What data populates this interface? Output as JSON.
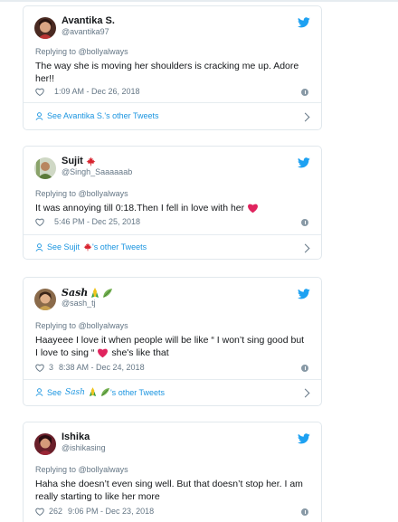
{
  "colors": {
    "twitter_blue": "#1da1f2",
    "link_blue": "#1b95e0",
    "muted": "#657786",
    "heart_red": "#e0245e"
  },
  "tweets": [
    {
      "name": "Avantika S.",
      "handle": "@avantika97",
      "replying_to": "Replying to @bollyalways",
      "text": "The way she is moving her shoulders is cracking me up. Adore her!!",
      "likes": "",
      "time": "1:09 AM - Dec 26, 2018",
      "see_more": "See Avantika S.'s other Tweets"
    },
    {
      "name": "Sujit",
      "handle": "@Singh_Saaaaaab",
      "replying_to": "Replying to @bollyalways",
      "text": "It was annoying till 0:18.Then I fell in love with her",
      "likes": "",
      "time": "5:46 PM - Dec 25, 2018",
      "see_more_prefix": "See Sujit",
      "see_more_suffix": "'s other Tweets"
    },
    {
      "name": "Sash",
      "handle": "@sash_tj",
      "replying_to": "Replying to @bollyalways",
      "text_line1": "Haayeee I love it when people will be like “ I won’t sing good but",
      "text_line2_a": "I love to sing “",
      "text_line2_b": "she's like that",
      "likes": "3",
      "time": "8:38 AM - Dec 24, 2018",
      "see_more_prefix": "See",
      "see_more_name": "Sash",
      "see_more_suffix": "'s other Tweets"
    },
    {
      "name": "Ishika",
      "handle": "@ishikasing",
      "replying_to": "Replying to @bollyalways",
      "text": "Haha she doesn’t even sing well. But that doesn’t stop her. I am really starting to like her more",
      "likes": "262",
      "time": "9:06 PM - Dec 23, 2018"
    }
  ]
}
